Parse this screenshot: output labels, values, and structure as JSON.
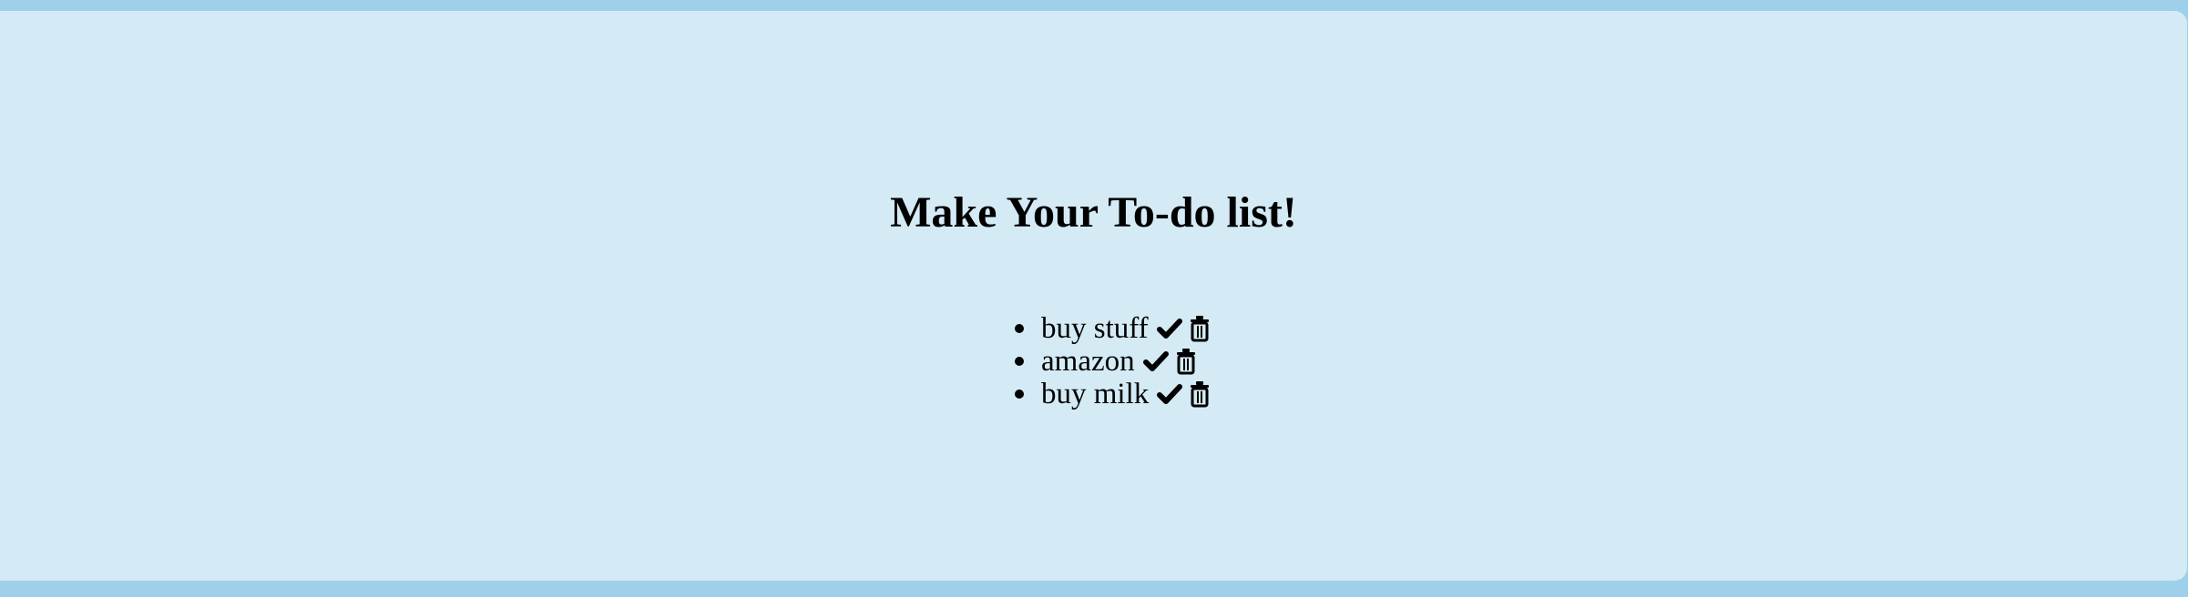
{
  "page": {
    "title": "Make Your To-do list!"
  },
  "todos": [
    {
      "text": "buy stuff",
      "complete_icon": "check-icon",
      "delete_icon": "trash-icon"
    },
    {
      "text": "amazon",
      "complete_icon": "check-icon",
      "delete_icon": "trash-icon"
    },
    {
      "text": "buy milk",
      "complete_icon": "check-icon",
      "delete_icon": "trash-icon"
    }
  ],
  "colors": {
    "outer_background": "#9fd0ea",
    "panel_background": "#d4ebf6",
    "text": "#000000"
  }
}
